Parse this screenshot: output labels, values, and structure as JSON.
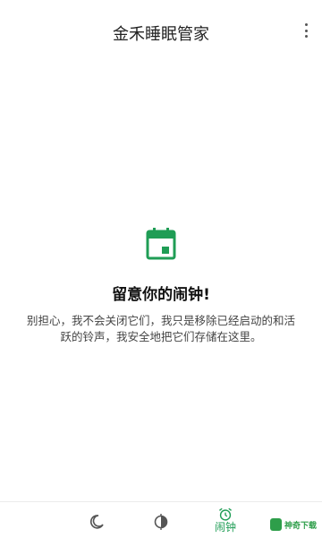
{
  "app_bar": {
    "title": "金禾睡眠管家",
    "more_icon": "more-vert-icon"
  },
  "empty_state": {
    "icon": "calendar-icon",
    "title": "留意你的闹钟!",
    "description": "别担心，我不会关闭它们，我只是移除已经启动的和活跃的铃声，我安全地把它们存储在这里。"
  },
  "bottom_nav": {
    "items": [
      {
        "icon": "moon-icon",
        "label": ""
      },
      {
        "icon": "tips-icon",
        "label": ""
      },
      {
        "icon": "alarm-clock-icon",
        "label": "闹钟"
      }
    ]
  },
  "colors": {
    "accent": "#1f9d55",
    "text_primary": "#111111",
    "text_secondary": "#444444"
  },
  "watermark": {
    "text": "神奇下载"
  }
}
